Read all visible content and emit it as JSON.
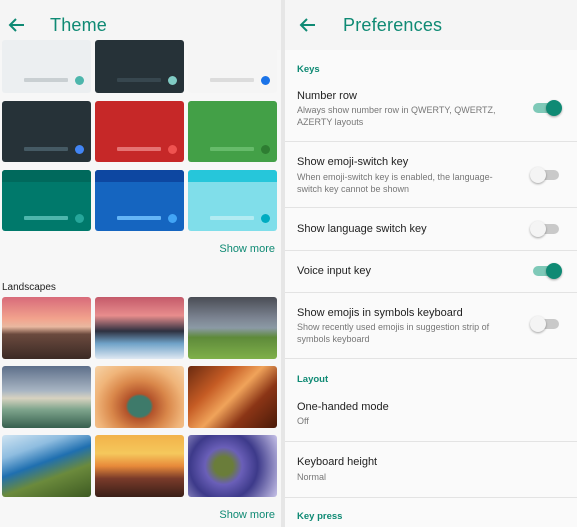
{
  "theme_panel": {
    "title": "Theme",
    "show_more_1": "Show more",
    "landscapes_label": "Landscapes",
    "show_more_2": "Show more",
    "color_tiles": [
      {
        "bg": "#eceff1",
        "bar": "#c9cfd2",
        "dot": "#4db6ac"
      },
      {
        "bg": "#263238",
        "bar": "#37474f",
        "dot": "#80cbc4"
      },
      {
        "bg": "#f5f5f5",
        "bar": "#dcdcdc",
        "dot": "#1a73e8"
      },
      {
        "bg": "#263238",
        "bar": "#455a64",
        "dot": "#4285f4"
      },
      {
        "bg": "#c62828",
        "bar": "#e57373",
        "dot": "#ef5350"
      },
      {
        "bg": "#43a047",
        "bar": "#66bb6a",
        "dot": "#2e7d32"
      },
      {
        "bg": "#00796b",
        "bar": "#4db6ac",
        "dot": "#26a69a"
      },
      {
        "bg": "#1565c0",
        "bar": "#64b5f6",
        "dot": "#42a5f5"
      },
      {
        "bg": "#80deea",
        "bar": "#b2ebf2",
        "dot": "#00acc1"
      }
    ]
  },
  "preferences_panel": {
    "title": "Preferences",
    "keys_section": "Keys",
    "layout_section": "Layout",
    "keypress_section": "Key press",
    "number_row": {
      "title": "Number row",
      "summary": "Always show number row in QWERTY, QWERTZ, AZERTY layouts",
      "enabled": true
    },
    "emoji_switch": {
      "title": "Show emoji-switch key",
      "summary": "When emoji-switch key is enabled, the language-switch key cannot be shown",
      "enabled": false
    },
    "language_switch": {
      "title": "Show language switch key",
      "enabled": false
    },
    "voice_input": {
      "title": "Voice input key",
      "enabled": true
    },
    "emojis_symbols": {
      "title": "Show emojis in symbols keyboard",
      "summary": "Show recently used emojis in suggestion strip of symbols keyboard",
      "enabled": false
    },
    "one_handed": {
      "title": "One-handed mode",
      "value": "Off"
    },
    "keyboard_height": {
      "title": "Keyboard height",
      "value": "Normal"
    }
  },
  "colors": {
    "accent": "#0f8a74"
  }
}
